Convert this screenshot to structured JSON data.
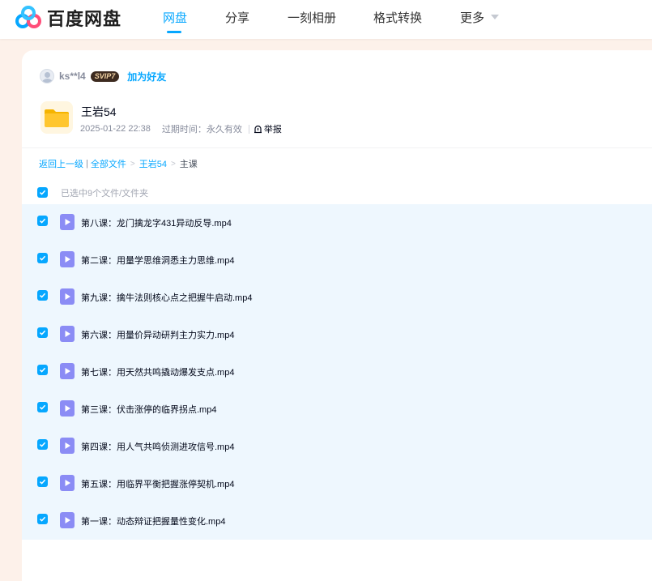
{
  "brand": {
    "name": "百度网盘",
    "accent": "#06a7ff"
  },
  "nav": {
    "items": [
      {
        "label": "网盘",
        "active": true
      },
      {
        "label": "分享",
        "active": false
      },
      {
        "label": "一刻相册",
        "active": false
      },
      {
        "label": "格式转换",
        "active": false
      },
      {
        "label": "更多",
        "active": false
      }
    ]
  },
  "sharer": {
    "username": "ks**l4",
    "vip_badge": "SVIP7",
    "add_friend": "加为好友"
  },
  "folder": {
    "name": "王岩54",
    "date": "2025-01-22 22:38",
    "expire": "过期时间：永久有效",
    "report": "举报"
  },
  "breadcrumb": {
    "back": "返回上一级",
    "separator": "|",
    "all_files": "全部文件",
    "folder": "王岩54",
    "current": "主课"
  },
  "selection": {
    "label": "已选中9个文件/文件夹"
  },
  "files": [
    {
      "name": "第八课：龙门擒龙字431异动反导.mp4",
      "checked": true
    },
    {
      "name": "第二课：用量学思维洞悉主力思维.mp4",
      "checked": true
    },
    {
      "name": "第九课：擒牛法则核心点之把握牛启动.mp4",
      "checked": true
    },
    {
      "name": "第六课：用量价异动研判主力实力.mp4",
      "checked": true
    },
    {
      "name": "第七课：用天然共鸣撬动爆发支点.mp4",
      "checked": true
    },
    {
      "name": "第三课：伏击涨停的临界拐点.mp4",
      "checked": true
    },
    {
      "name": "第四课：用人气共鸣侦测进攻信号.mp4",
      "checked": true
    },
    {
      "name": "第五课：用临界平衡把握涨停契机.mp4",
      "checked": true
    },
    {
      "name": "第一课：动态辩证把握量性变化.mp4",
      "checked": true
    }
  ]
}
